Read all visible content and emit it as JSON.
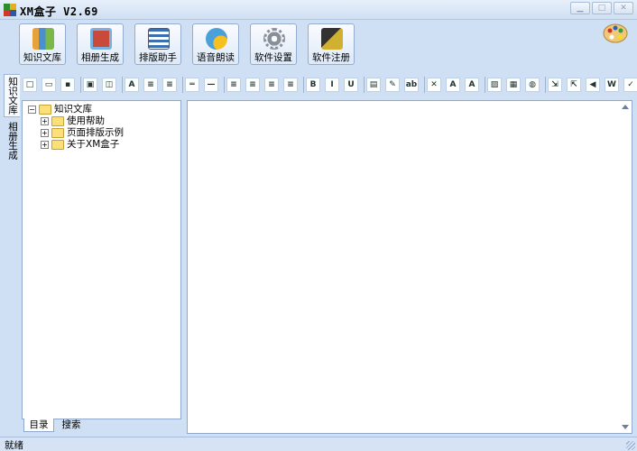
{
  "window": {
    "title": "XM盒子 V2.69",
    "controls": [
      "minimize",
      "maximize",
      "close"
    ]
  },
  "main_toolbar": {
    "buttons": [
      {
        "label": "知识文库",
        "icon": "books-icon",
        "color": "#e8a23a"
      },
      {
        "label": "相册生成",
        "icon": "photo-album-icon",
        "color": "#c94a3a"
      },
      {
        "label": "排版助手",
        "icon": "layout-icon",
        "color": "#3b6fb0"
      },
      {
        "label": "语音朗读",
        "icon": "speech-icon",
        "color": "#4aa0d8"
      },
      {
        "label": "软件设置",
        "icon": "gear-icon",
        "color": "#8a8f98"
      },
      {
        "label": "软件注册",
        "icon": "key-icon",
        "color": "#d0b030"
      }
    ],
    "palette_icon": "palette-icon"
  },
  "side_tabs": [
    "知识文库",
    "相册生成"
  ],
  "format_toolbar": {
    "buttons": [
      {
        "name": "new-icon",
        "glyph": "□"
      },
      {
        "name": "open-icon",
        "glyph": "▭"
      },
      {
        "name": "save-icon",
        "glyph": "▪"
      },
      {
        "name": "print-icon",
        "glyph": "▣"
      },
      {
        "name": "preview-icon",
        "glyph": "◫"
      },
      {
        "name": "find-icon",
        "glyph": "A"
      },
      {
        "name": "indent-decrease-icon",
        "glyph": "≡"
      },
      {
        "name": "indent-increase-icon",
        "glyph": "≡"
      },
      {
        "name": "hr-double-icon",
        "glyph": "═"
      },
      {
        "name": "hr-icon",
        "glyph": "—"
      },
      {
        "name": "align-left-icon",
        "glyph": "≡"
      },
      {
        "name": "align-center-icon",
        "glyph": "≡"
      },
      {
        "name": "align-right-icon",
        "glyph": "≡"
      },
      {
        "name": "justify-icon",
        "glyph": "≡"
      },
      {
        "name": "bold-icon",
        "glyph": "B"
      },
      {
        "name": "italic-icon",
        "glyph": "I"
      },
      {
        "name": "underline-icon",
        "glyph": "U"
      },
      {
        "name": "insert-folder-icon",
        "glyph": "▤"
      },
      {
        "name": "format-painter-icon",
        "glyph": "✎"
      },
      {
        "name": "spell-check-icon",
        "glyph": "ab"
      },
      {
        "name": "clear-format-icon",
        "glyph": "✕"
      },
      {
        "name": "font-color-icon",
        "glyph": "A"
      },
      {
        "name": "highlight-icon",
        "glyph": "A"
      },
      {
        "name": "insert-image-icon",
        "glyph": "▨"
      },
      {
        "name": "insert-table-icon",
        "glyph": "▦"
      },
      {
        "name": "insert-link-icon",
        "glyph": "◍"
      },
      {
        "name": "import-icon",
        "glyph": "⇲"
      },
      {
        "name": "export-icon",
        "glyph": "⇱"
      },
      {
        "name": "speaker-icon",
        "glyph": "◀"
      },
      {
        "name": "word-icon",
        "glyph": "W"
      },
      {
        "name": "clean-icon",
        "glyph": "✓"
      }
    ]
  },
  "tree": {
    "root": {
      "label": "知识文库",
      "expanded": true
    },
    "children": [
      {
        "label": "使用帮助"
      },
      {
        "label": "页面排版示例"
      },
      {
        "label": "关于XM盒子"
      }
    ]
  },
  "left_bottom_tabs": [
    "目录",
    "搜索"
  ],
  "status": {
    "text": "就绪"
  }
}
